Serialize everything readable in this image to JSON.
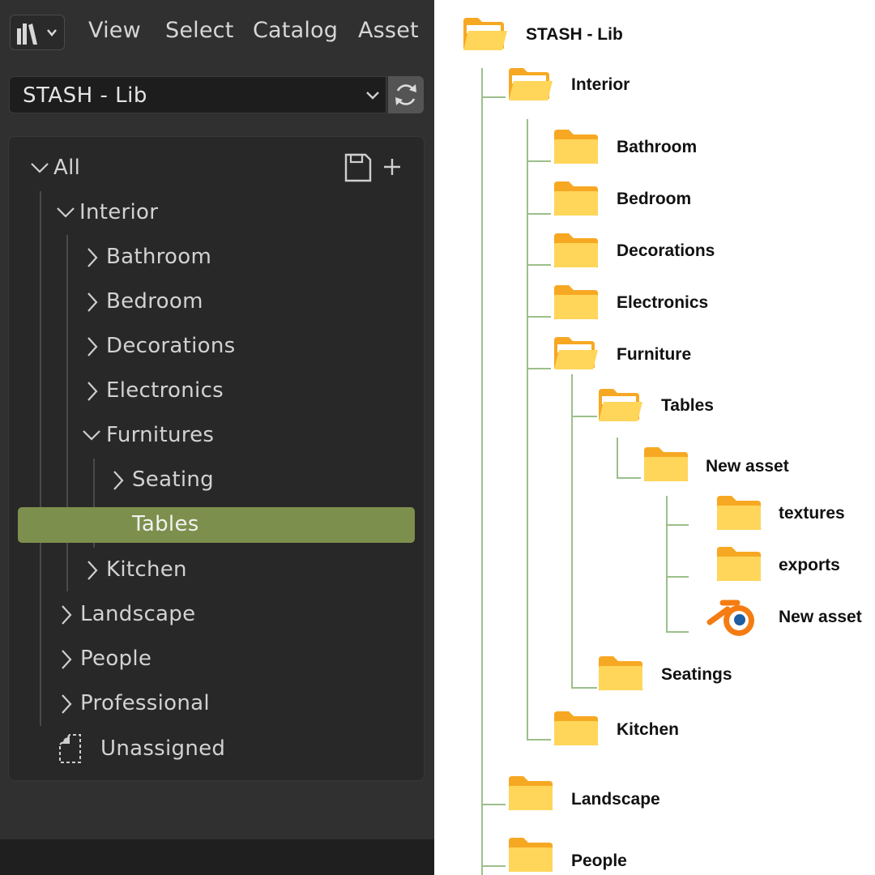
{
  "menubar": {
    "items": [
      "View",
      "Select",
      "Catalog",
      "Asset"
    ]
  },
  "library_selector": {
    "value": "STASH - Lib"
  },
  "catalog_tree": {
    "root": "All",
    "interior": "Interior",
    "bathroom": "Bathroom",
    "bedroom": "Bedroom",
    "decorations": "Decorations",
    "electronics": "Electronics",
    "furnitures": "Furnitures",
    "seating": "Seating",
    "tables": "Tables",
    "kitchen": "Kitchen",
    "landscape": "Landscape",
    "people": "People",
    "professional": "Professional",
    "unassigned": "Unassigned"
  },
  "diagram": {
    "root": "STASH - Lib",
    "interior": "Interior",
    "bathroom": "Bathroom",
    "bedroom": "Bedroom",
    "decorations": "Decorations",
    "electronics": "Electronics",
    "furniture": "Furniture",
    "tables": "Tables",
    "new_asset_folder": "New asset",
    "textures": "textures",
    "exports": "exports",
    "new_asset_file": "New asset",
    "seatings": "Seatings",
    "kitchen": "Kitchen",
    "landscape": "Landscape",
    "people": "People"
  },
  "colors": {
    "panel_bg": "#303030",
    "tree_bg": "#282828",
    "selection": "#7c8f4c",
    "folder_yellow": "#ffd65a",
    "folder_tab": "#f7a823",
    "guide_line": "#9cbf8a",
    "blender_orange": "#f47c12",
    "blender_blue": "#1f5fa0"
  }
}
